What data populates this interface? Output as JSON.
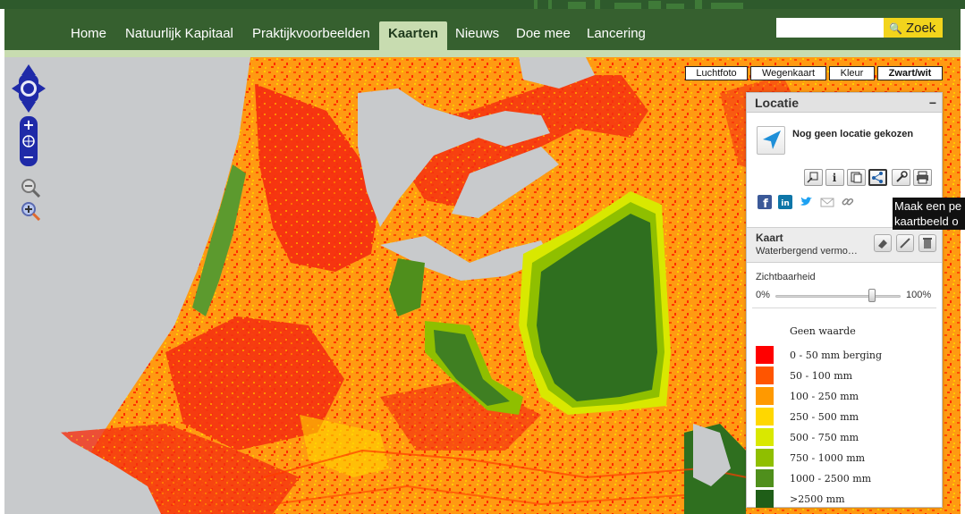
{
  "nav": {
    "items": [
      {
        "label": "Home",
        "active": false
      },
      {
        "label": "Natuurlijk Kapitaal",
        "active": false
      },
      {
        "label": "Praktijkvoorbeelden",
        "active": false
      },
      {
        "label": "Kaarten",
        "active": true
      },
      {
        "label": "Nieuws",
        "active": false
      },
      {
        "label": "Doe mee",
        "active": false
      },
      {
        "label": "Lancering",
        "active": false
      }
    ]
  },
  "search": {
    "placeholder": "",
    "value": "",
    "button_label": "Zoek",
    "icon": "search-icon"
  },
  "map_types": [
    {
      "label": "Luchtfoto",
      "active": false
    },
    {
      "label": "Wegenkaart",
      "active": false
    },
    {
      "label": "Kleur",
      "active": false
    },
    {
      "label": "Zwart/wit",
      "active": true
    }
  ],
  "location_panel": {
    "title": "Locatie",
    "collapse_symbol": "−",
    "status": "Nog geen locatie gekozen",
    "tools": [
      "zoom-to-icon",
      "info-icon",
      "layers-icon",
      "share-icon",
      "wrench-icon",
      "print-icon"
    ],
    "active_tool": "share-icon",
    "social": [
      "facebook-icon",
      "linkedin-icon",
      "twitter-icon",
      "mail-icon",
      "link-icon"
    ]
  },
  "tooltip": {
    "line1": "Maak een pe",
    "line2": "kaartbeeld o"
  },
  "map_panel": {
    "title": "Kaart",
    "subtitle": "Waterbergend vermo…",
    "tools": [
      "eraser-icon",
      "edit-icon",
      "trash-icon"
    ]
  },
  "visibility": {
    "label": "Zichtbaarheid",
    "min_label": "0%",
    "max_label": "100%",
    "value": 0.77
  },
  "legend": {
    "none_label": "Geen waarde",
    "items": [
      {
        "label": "0 - 50 mm berging",
        "color": "#ff0000"
      },
      {
        "label": "50 - 100 mm",
        "color": "#ff5500"
      },
      {
        "label": "100 - 250 mm",
        "color": "#ff9900"
      },
      {
        "label": "250 - 500 mm",
        "color": "#ffd700"
      },
      {
        "label": "500 - 750 mm",
        "color": "#d9e800"
      },
      {
        "label": "750 - 1000 mm",
        "color": "#8fbf00"
      },
      {
        "label": "1000 - 2500 mm",
        "color": "#4f8f1c"
      },
      {
        "label": ">2500 mm",
        "color": "#1f5e18"
      }
    ]
  },
  "colors": {
    "header_green": "#36602f",
    "accent_yellow": "#f2d41c",
    "water": "#c8cacc"
  }
}
